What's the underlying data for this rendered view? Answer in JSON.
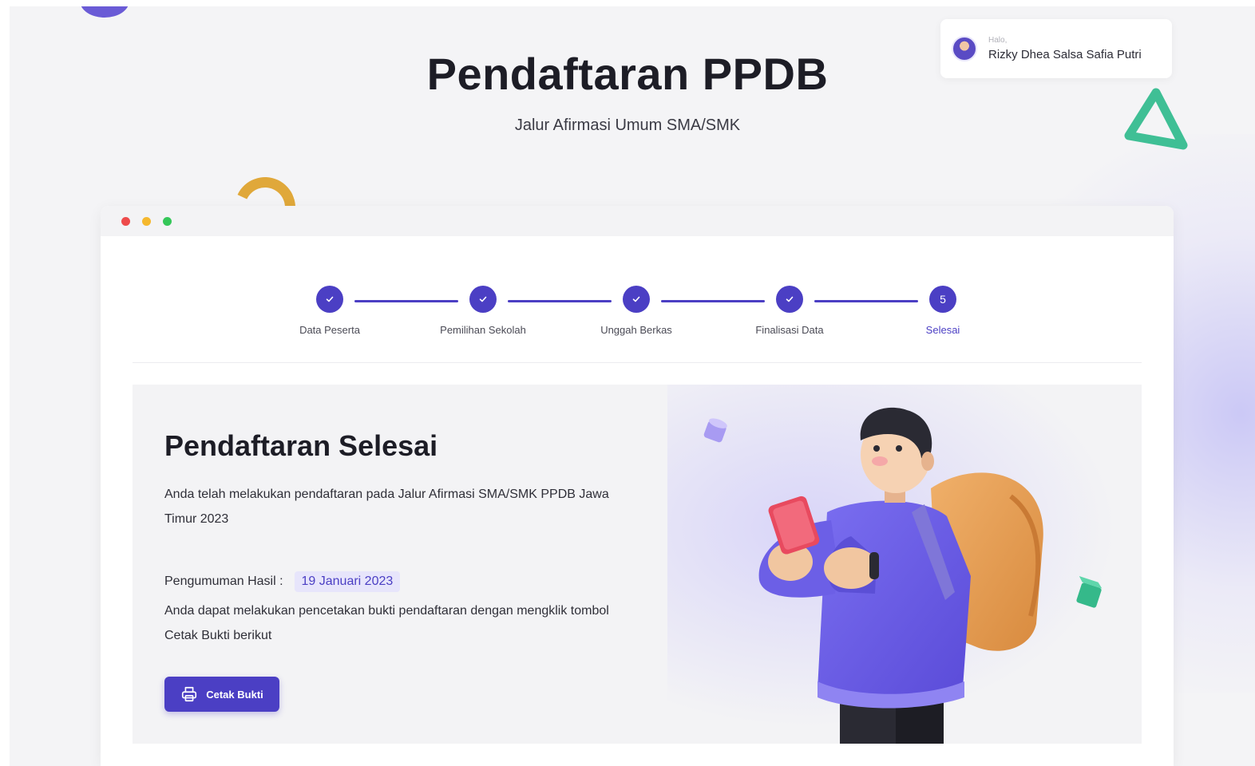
{
  "header": {
    "title": "Pendaftaran PPDB",
    "subtitle": "Jalur Afirmasi Umum SMA/SMK"
  },
  "user": {
    "greeting": "Halo,",
    "name": "Rizky Dhea Salsa Safia Putri"
  },
  "window_controls": {
    "colors": [
      "#ee4b4b",
      "#f5b82e",
      "#35c759"
    ]
  },
  "stepper": {
    "steps": [
      {
        "label": "Data Peserta",
        "status": "done",
        "icon": "check-icon"
      },
      {
        "label": "Pemilihan Sekolah",
        "status": "done",
        "icon": "check-icon"
      },
      {
        "label": "Unggah Berkas",
        "status": "done",
        "icon": "check-icon"
      },
      {
        "label": "Finalisasi Data",
        "status": "done",
        "icon": "check-icon"
      },
      {
        "label": "Selesai",
        "status": "active",
        "number": "5"
      }
    ]
  },
  "completion": {
    "title": "Pendaftaran Selesai",
    "description": "Anda telah melakukan pendaftaran pada Jalur Afirmasi SMA/SMK PPDB Jawa Timur 2023",
    "announcement_label": "Pengumuman Hasil :",
    "announcement_date": "19 Januari 2023",
    "print_description": "Anda dapat melakukan pencetakan bukti pendaftaran dengan mengklik tombol Cetak Bukti berikut",
    "print_button_label": "Cetak Bukti",
    "print_button_icon": "printer-icon"
  },
  "colors": {
    "primary": "#4b3fc4",
    "accent_green": "#3fbf95",
    "accent_yellow": "#e0a83a"
  }
}
